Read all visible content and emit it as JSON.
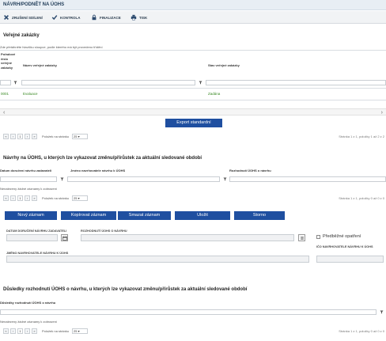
{
  "header": {
    "title": "NÁVRH/PODNĚT NA ÚOHS"
  },
  "toolbar": {
    "clear_label": "ZRUŠENÍ SDÍLENÍ",
    "check_label": "KONTROLA",
    "finalize_label": "FINALIZACE",
    "print_label": "TISK"
  },
  "section1": {
    "title": "Veřejné zakázky",
    "note": "Zde přetáhněte hlavičku sloupce, podle kterého má být provedeno třídění",
    "col_no_label": "Pořadové číslo veřejné zakázky",
    "col_name_label": "Název veřejné zakázky",
    "col_state_label": "Stav veřejné zakázky",
    "row": {
      "no": "0001",
      "name": "Evaluace",
      "state": "Zadána"
    },
    "export_label": "Export standardní",
    "page_size_label": "Položek na stránku",
    "page_size_value": "25",
    "page_current": "1",
    "page_info": "Stránka 1 z 1, položky 1 až 2 z 2"
  },
  "section2": {
    "title": "Návrhy na ÚOHS, u kterých lze vykazovat změnu/přírůstek za aktuální sledované období",
    "col_date_label": "Datum doručení návrhu zadavateli",
    "col_proposer_label": "Jméno navrhovatele návrhu k ÚOHS",
    "col_decision_label": "Rozhodnutí ÚOHS o návrhu",
    "empty_text": "Nenalezeny žádné záznamy k zobrazení",
    "page_size_label": "Položek na stránku",
    "page_size_value": "25",
    "page_current": "1",
    "page_info": "Stránka 1 z 1, položky 0 až 0 z 0"
  },
  "actions": {
    "new_label": "Nový záznam",
    "copy_label": "Kopírovat záznam",
    "delete_label": "Smazat záznam",
    "save_label": "Uložit",
    "cancel_label": "Storno"
  },
  "form": {
    "date_label": "DATUM DORUČENÍ NÁVRHU ZADAVATELI",
    "decision_label": "ROZHODNUTÍ ÚOHS O NÁVRHU",
    "prelim_label": "Předběžné opatření",
    "proposer_label": "JMÉNO NAVRHOVATELE NÁVRHU K ÚOHS",
    "ico_label": "IČO NAVRHOVATELE NÁVRHU K ÚOHS"
  },
  "section3": {
    "title": "Důsledky rozhodnutí ÚOHS o návrhu, u kterých lze vykazovat změnu/přírůstek za aktuální sledované období",
    "col_label": "Důsledky rozhodnutí ÚOHS o návrhu",
    "empty_text": "Nenalezeny žádné záznamy k zobrazení",
    "page_size_label": "Položek na stránku",
    "page_size_value": "25",
    "page_current": "1",
    "page_info": "Stránka 1 z 1, položky 0 až 0 z 0"
  },
  "pager_icons": [
    "first-page-icon",
    "prev-page-icon",
    "next-page-icon",
    "last-page-icon"
  ],
  "colors": {
    "accent": "#1f4fa0",
    "link_green": "#3a8a25",
    "header_bg": "#e8eef4"
  }
}
